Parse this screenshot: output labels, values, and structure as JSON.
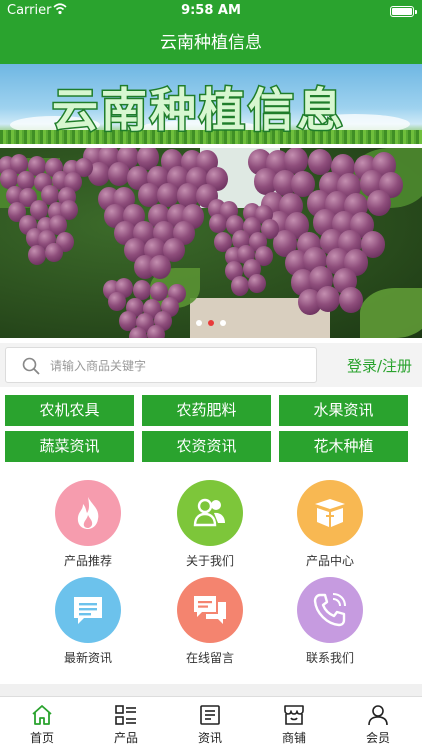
{
  "status_bar": {
    "carrier": "Carrier",
    "time": "9:58 AM"
  },
  "nav": {
    "title": "云南种植信息"
  },
  "banner": {
    "title": "云南种植信息"
  },
  "slider": {
    "total": 3,
    "active": 2,
    "active_color": "#e83a3a",
    "inactive_color": "#ffffff"
  },
  "search": {
    "placeholder": "请输入商品关键字",
    "login_label": "登录/注册"
  },
  "categories": [
    "农机农具",
    "农药肥料",
    "水果资讯",
    "蔬菜资讯",
    "农资资讯",
    "花木种植"
  ],
  "features": [
    {
      "label": "产品推荐",
      "icon": "flame-icon",
      "color": "#f69cae"
    },
    {
      "label": "关于我们",
      "icon": "people-icon",
      "color": "#7dc63a"
    },
    {
      "label": "产品中心",
      "icon": "box-icon",
      "color": "#f8b852"
    },
    {
      "label": "最新资讯",
      "icon": "message-icon",
      "color": "#6cc2ec"
    },
    {
      "label": "在线留言",
      "icon": "chat-bubbles-icon",
      "color": "#f4846f"
    },
    {
      "label": "联系我们",
      "icon": "phone-icon",
      "color": "#c69be0"
    }
  ],
  "tabs": [
    {
      "label": "首页",
      "icon": "home-icon",
      "active": true
    },
    {
      "label": "产品",
      "icon": "grid-list-icon",
      "active": false
    },
    {
      "label": "资讯",
      "icon": "newspaper-icon",
      "active": false
    },
    {
      "label": "商铺",
      "icon": "shop-icon",
      "active": false
    },
    {
      "label": "会员",
      "icon": "user-icon",
      "active": false
    }
  ],
  "colors": {
    "brand": "#2aa32e",
    "tab_active": "#2aa32e"
  }
}
